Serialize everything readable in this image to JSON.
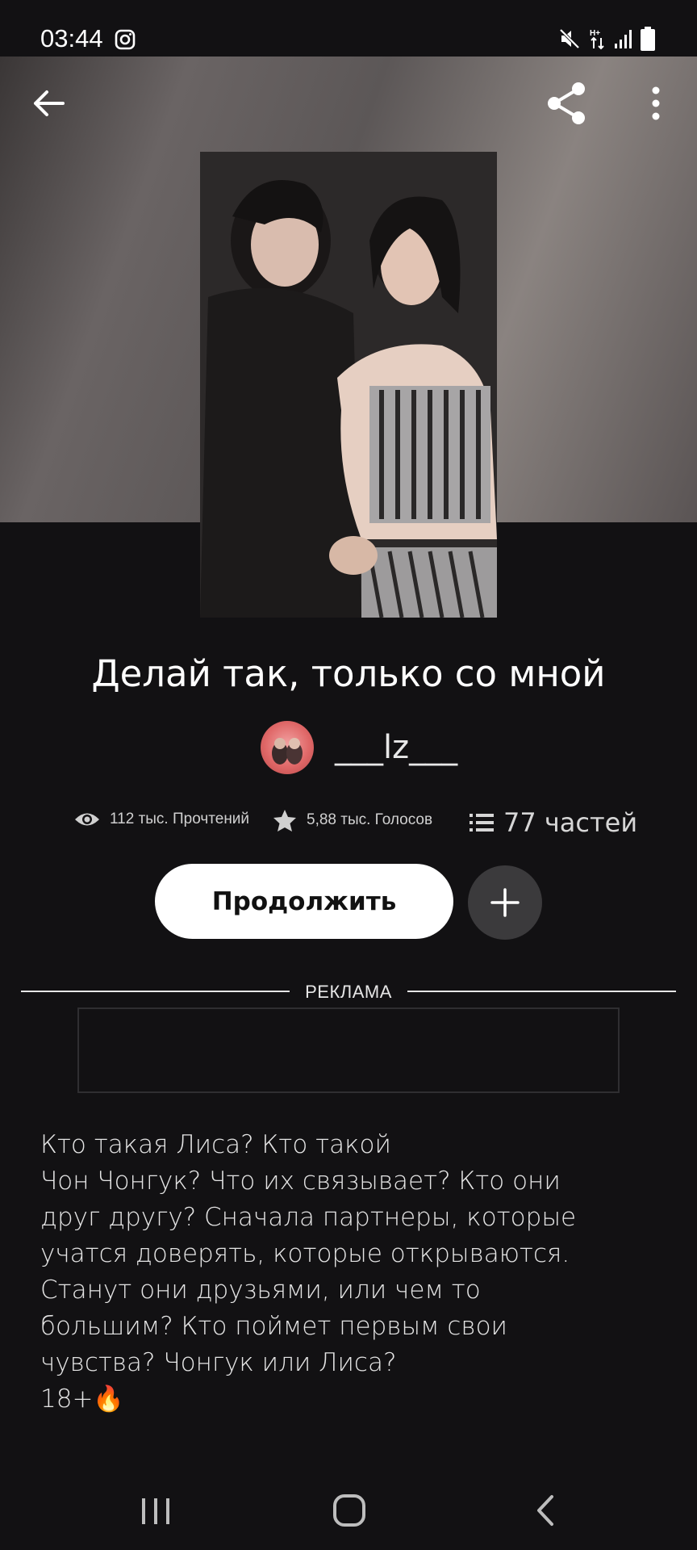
{
  "status_bar": {
    "time": "03:44",
    "icons": [
      "instagram-icon",
      "mute-icon",
      "mobile-data-icon",
      "signal-icon",
      "battery-icon"
    ]
  },
  "header": {
    "icons": [
      "back-arrow-icon",
      "share-icon",
      "more-vertical-icon"
    ]
  },
  "story": {
    "title": "Делай так, только со мной",
    "author": "___lz___",
    "stats": {
      "reads": "112 тыс. Прочтений",
      "votes": "5,88 тыс. Голосов",
      "parts": "77 частей"
    },
    "continue_label": "Продолжить",
    "description": "Кто такая Лиса? Кто такой\nЧон Чонгук? Что их связывает? Кто они друг другу? Сначала партнеры, которые учатся доверять, которые открываются. Станут они друзьями, или чем то большим? Кто поймет первым свои чувства? Чонгук или Лиса?\n18+🔥"
  },
  "ad": {
    "label": "РЕКЛАМА"
  },
  "nav_bar": {
    "icons": [
      "recent-apps-icon",
      "home-icon",
      "back-icon"
    ]
  },
  "colors": {
    "background": "#121113",
    "button_primary": "#ffffff",
    "button_secondary": "#3b3a3c",
    "text": "#ffffff"
  }
}
